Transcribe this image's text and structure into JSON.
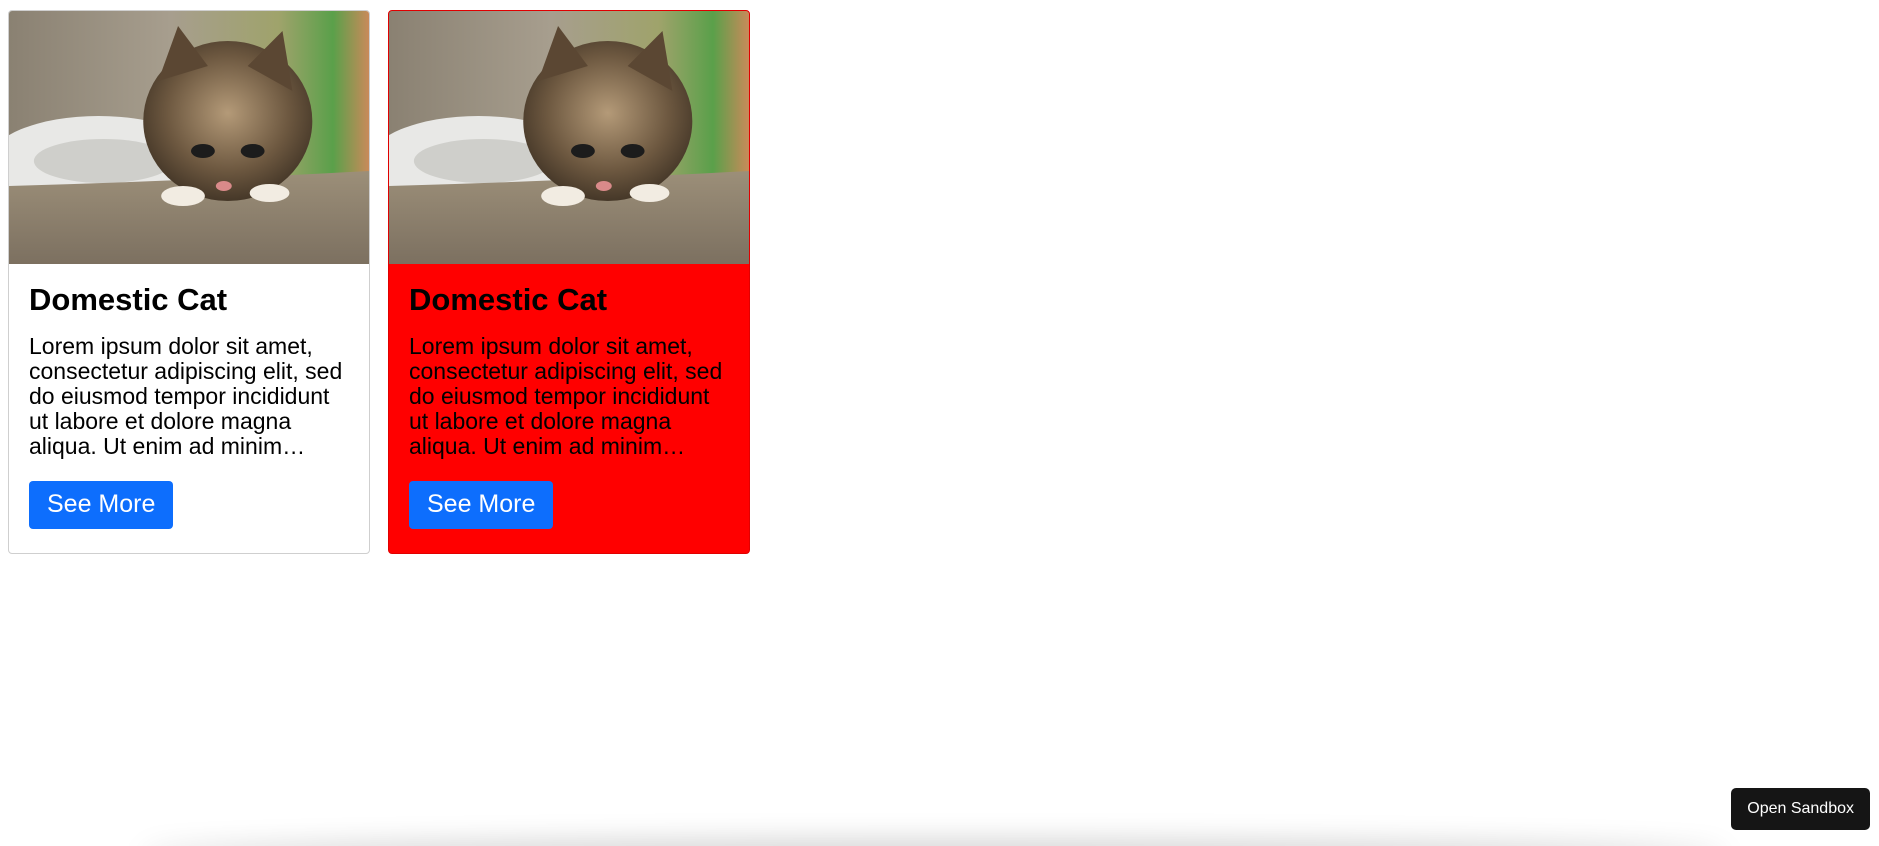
{
  "cards": [
    {
      "image_alt": "kitten",
      "title": "Domestic Cat",
      "text": "Lorem ipsum dolor sit amet, consectetur adipiscing elit, sed do eiusmod tempor incididunt ut labore et dolore magna aliqua. Ut enim ad minim veniam, quis nostrud exercitation ullamco laboris nisi ut aliquip ex ea commodo consequat.",
      "button_label": "See More"
    },
    {
      "image_alt": "kitten",
      "title": "Domestic Cat",
      "text": "Lorem ipsum dolor sit amet, consectetur adipiscing elit, sed do eiusmod tempor incididunt ut labore et dolore magna aliqua. Ut enim ad minim veniam, quis nostrud exercitation ullamco laboris nisi ut aliquip ex ea commodo consequat.",
      "button_label": "See More",
      "background_color": "#ff0000"
    }
  ],
  "sandbox": {
    "button_label": "Open Sandbox"
  },
  "colors": {
    "button_primary": "#0d6efd",
    "sandbox_button": "#151515",
    "card_highlight": "#ff0000"
  }
}
